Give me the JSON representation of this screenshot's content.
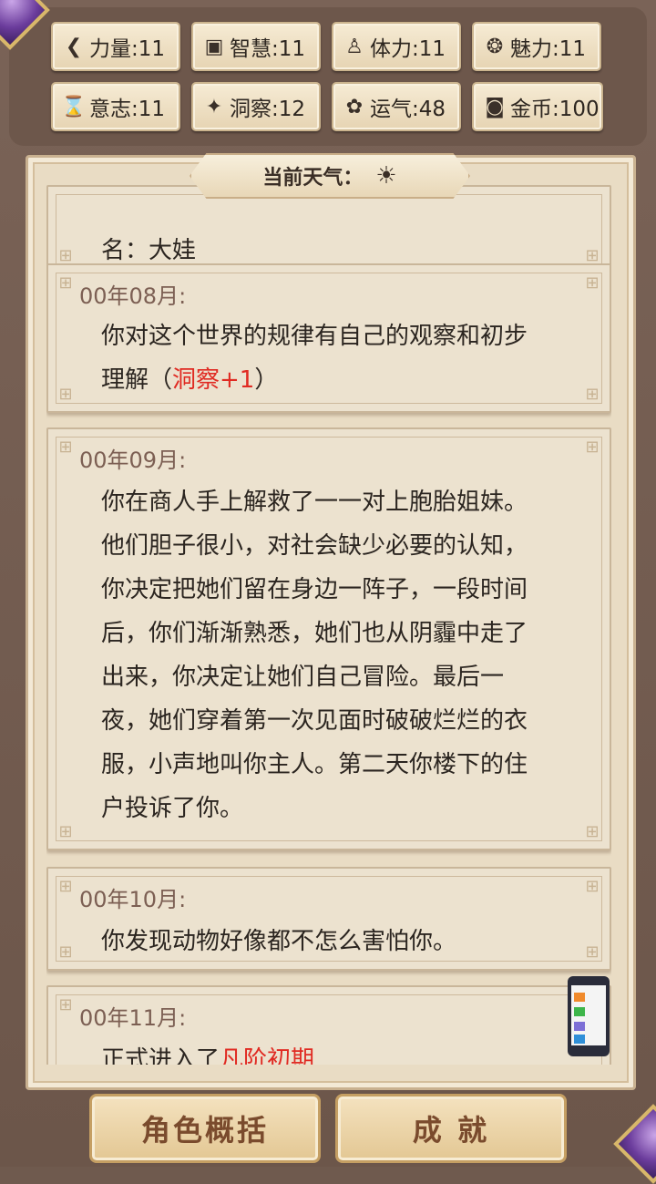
{
  "stats": [
    {
      "icon": "strength-icon",
      "glyph": "❮",
      "label": "力量:11"
    },
    {
      "icon": "wisdom-icon",
      "glyph": "▣",
      "label": "智慧:11"
    },
    {
      "icon": "stamina-icon",
      "glyph": "♙",
      "label": "体力:11"
    },
    {
      "icon": "charm-icon",
      "glyph": "❂",
      "label": "魅力:11"
    },
    {
      "icon": "willpower-icon",
      "glyph": "⌛",
      "label": "意志:11"
    },
    {
      "icon": "insight-icon",
      "glyph": "✦",
      "label": "洞察:12"
    },
    {
      "icon": "luck-icon",
      "glyph": "✿",
      "label": "运气:48"
    },
    {
      "icon": "coin-icon",
      "glyph": "◙",
      "label": "金币:100"
    }
  ],
  "weather": {
    "label": "当前天气：",
    "icon": "sun-icon",
    "glyph": "☀"
  },
  "events": [
    {
      "date": "",
      "text": "名：大娃",
      "highlight": ""
    },
    {
      "date": "00年08月:",
      "text": "你对这个世界的规律有自己的观察和初步理解（",
      "highlight": "洞察+1",
      "tail": "）"
    },
    {
      "date": "00年09月:",
      "text": "你在商人手上解救了一一对上胞胎姐妹。他们胆子很小，对社会缺少必要的认知，你决定把她们留在身边一阵子，一段时间后，你们渐渐熟悉，她们也从阴霾中走了出来，你决定让她们自己冒险。最后一夜，她们穿着第一次见面时破破烂烂的衣服，小声地叫你主人。第二天你楼下的住户投诉了你。",
      "highlight": ""
    },
    {
      "date": "00年10月:",
      "text": "你发现动物好像都不怎么害怕你。",
      "highlight": ""
    },
    {
      "date": "00年11月:",
      "text": "正式进入了",
      "highlight": "凡阶初期",
      "tail": ""
    }
  ],
  "buttons": {
    "summary": "角色概括",
    "achievements": "成 就"
  },
  "colors": {
    "accent_red": "#e02a22",
    "date_color": "#7c5f53",
    "button_text": "#7a4b2d"
  }
}
